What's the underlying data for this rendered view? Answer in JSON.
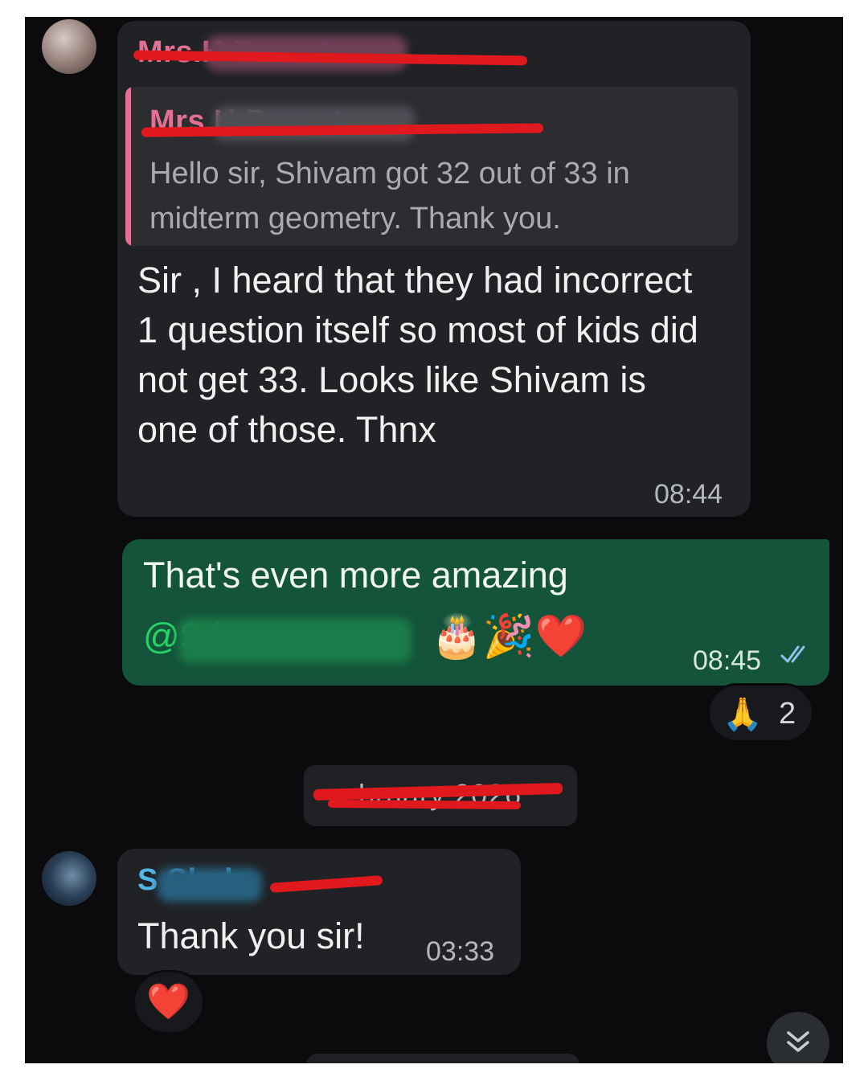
{
  "messages": [
    {
      "sender": "Mrs.H Parent",
      "quote": {
        "author": "Mrs H Parent",
        "text": "Hello sir, Shivam got 32 out of 33 in midterm geometry. Thank you."
      },
      "text": "Sir , I heard that they had incorrect 1 question itself so most of kids did not get 33. Looks like Shivam is one of those. Thnx",
      "time": "08:44"
    },
    {
      "outgoing": true,
      "text": "That's even more amazing",
      "mention": "@S h",
      "emojis": "🎂🎉❤️",
      "time": "08:45",
      "status_icon": "double-check-icon",
      "reaction": {
        "emoji": "🙏",
        "count": "2"
      }
    }
  ],
  "date_separator": "bruary 2026",
  "last_message": {
    "sender": "S Shah",
    "text": "Thank you sir!",
    "time": "03:33",
    "reaction_emoji": "❤️"
  },
  "scroll_button": {
    "icon": "chevron-double-down-icon",
    "glyph": "⌄"
  },
  "colors": {
    "background": "#0b0b0d",
    "incoming_bubble": "#202225",
    "outgoing_bubble": "#13543a",
    "sender_1": "#e36f93",
    "sender_2": "#4fb6e6",
    "mention": "#25d366",
    "read_ticks": "#8fc3ea",
    "redaction": "#e0191f"
  }
}
